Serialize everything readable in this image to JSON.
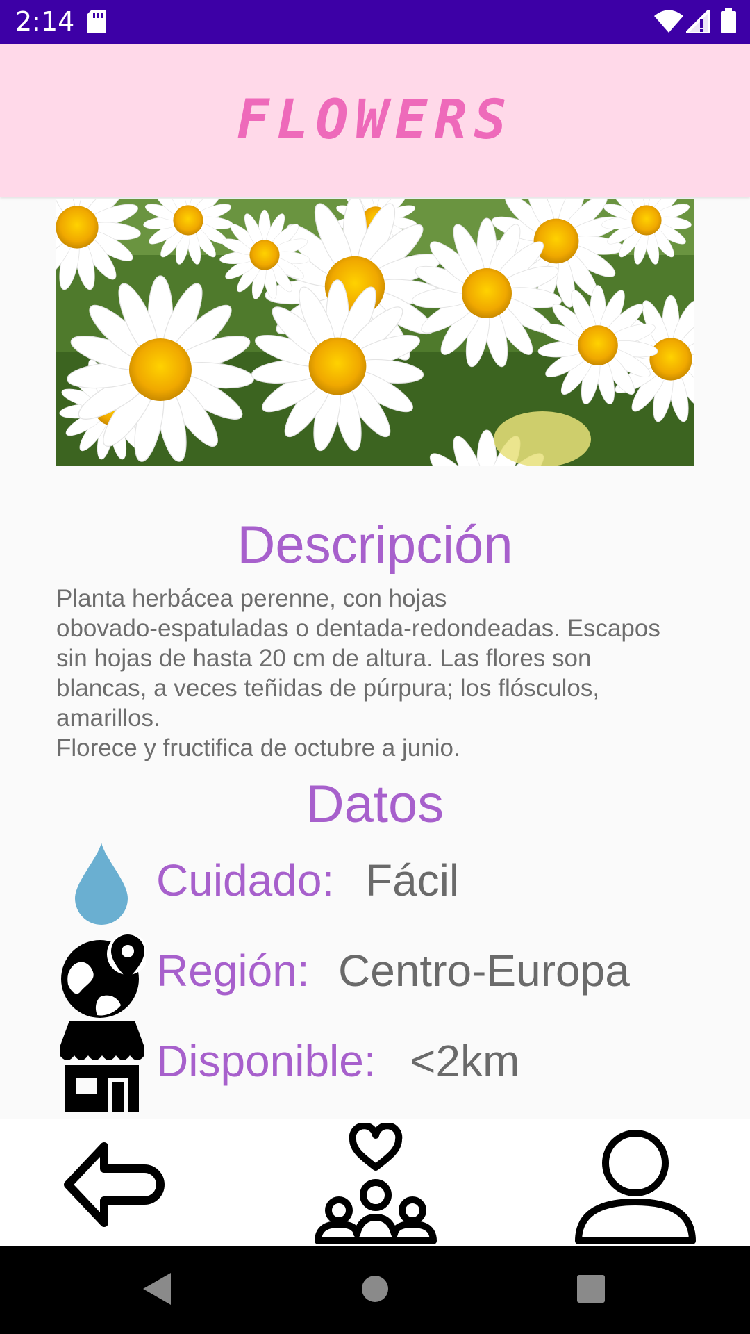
{
  "status_bar": {
    "time": "2:14",
    "icons": [
      "sd-card-icon",
      "wifi-icon",
      "cell-signal-icon",
      "battery-icon"
    ]
  },
  "app_bar": {
    "title": "FLOWERS",
    "title_color": "#ee6aba",
    "background": "#ffd9e9"
  },
  "photo": {
    "subject": "daisies"
  },
  "description": {
    "heading": "Descripción",
    "body": "Planta herbácea perenne, con hojas\nobovado-espatuladas o dentada-redondeadas. Escapos\nsin hojas de hasta 20 cm de altura. Las flores son\nblancas, a veces teñidas de púrpura; los flósculos,\namarillos.\nFlorece y fructifica de octubre a junio."
  },
  "data_section": {
    "heading": "Datos",
    "rows": [
      {
        "icon": "water-drop-icon",
        "label": "Cuidado:",
        "value": "Fácil"
      },
      {
        "icon": "globe-location-icon",
        "label": "Región:",
        "value": "Centro-Europa"
      },
      {
        "icon": "shop-icon",
        "label": "Disponible:",
        "value": "<2km"
      }
    ]
  },
  "bottom_nav": {
    "items": [
      "back-arrow-icon",
      "community-heart-icon",
      "user-profile-icon"
    ]
  },
  "system_nav": {
    "items": [
      "back-triangle-icon",
      "home-circle-icon",
      "recents-square-icon"
    ]
  },
  "colors": {
    "accent": "#a760cc",
    "status_bar": "#3d00a6",
    "body_text": "#6d6d6d"
  }
}
